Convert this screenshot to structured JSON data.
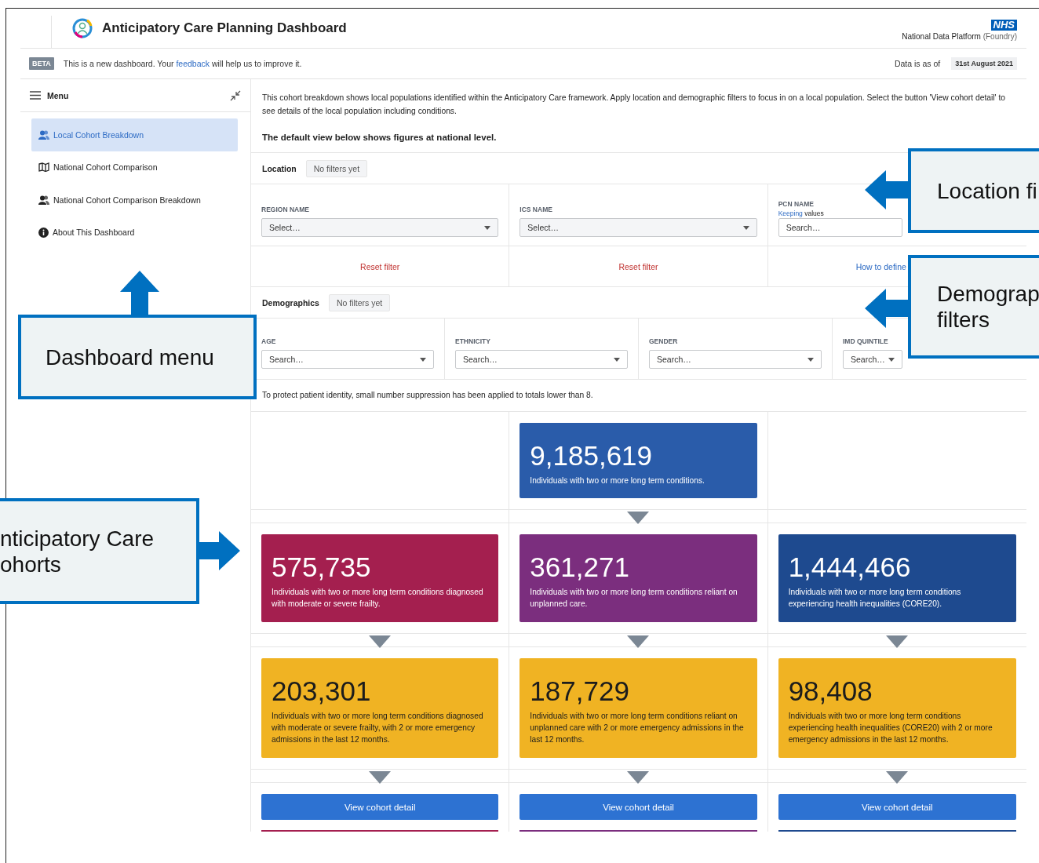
{
  "header": {
    "title": "Anticipatory Care Planning Dashboard",
    "badge": "NHS",
    "platform": "National Data Platform",
    "platform_suffix": "(Foundry)"
  },
  "banner": {
    "badge": "BETA",
    "message_before": "This is a new dashboard. Your ",
    "link": "feedback",
    "message_after": " will help us to improve it.",
    "data_label": "Data is as of",
    "data_date": "31st August 2021"
  },
  "sidebar": {
    "title": "Menu",
    "items": [
      {
        "label": "Local Cohort Breakdown",
        "kind": "people",
        "selected": true
      },
      {
        "label": "National Cohort Comparison",
        "kind": "map",
        "selected": false
      },
      {
        "label": "National Cohort Comparison Breakdown",
        "kind": "people",
        "selected": false
      },
      {
        "label": "About This Dashboard",
        "kind": "info",
        "selected": false
      }
    ]
  },
  "intro": {
    "text": "This cohort breakdown shows local populations identified within the Anticipatory Care framework. Apply location and demographic filters to focus in on a local population. Select the button 'View cohort detail' to see details of the local population including conditions.",
    "note": "The default view below shows figures at national level."
  },
  "location": {
    "label": "Location",
    "status": "No filters yet",
    "filters": [
      {
        "label": "REGION NAME",
        "kind": "select",
        "placeholder": "Select…"
      },
      {
        "label": "ICS NAME",
        "kind": "select",
        "placeholder": "Select…"
      },
      {
        "label": "PCN NAME",
        "kind": "search",
        "hint_link": "Keeping",
        "hint_text": "values",
        "placeholder": "Search…"
      }
    ],
    "actions": [
      {
        "label": "Reset filter",
        "kind": "reset"
      },
      {
        "label": "Reset filter",
        "kind": "reset"
      },
      {
        "label": "How to define",
        "kind": "help"
      }
    ]
  },
  "demographics": {
    "label": "Demographics",
    "status": "No filters yet",
    "filters": [
      {
        "label": "AGE",
        "placeholder": "Search…"
      },
      {
        "label": "ETHNICITY",
        "placeholder": "Search…"
      },
      {
        "label": "GENDER",
        "placeholder": "Search…"
      },
      {
        "label": "IMD QUINTILE",
        "placeholder": "Search…"
      }
    ]
  },
  "suppression_note": "To protect patient identity, small number suppression has been applied to totals lower than 8.",
  "cohorts": {
    "top": {
      "value": "9,185,619",
      "description": "Individuals with two or more long term conditions.",
      "color": "#2a5caa"
    },
    "tiers": [
      {
        "cards": [
          {
            "value": "575,735",
            "description": "Individuals with two or more long term conditions diagnosed with moderate or severe frailty.",
            "color": "#a41f4f"
          },
          {
            "value": "361,271",
            "description": "Individuals with two or more long term conditions reliant on unplanned care.",
            "color": "#7b2e7e"
          },
          {
            "value": "1,444,466",
            "description": "Individuals with two or more long term conditions experiencing health inequalities (CORE20).",
            "color": "#1e4a8f"
          }
        ]
      },
      {
        "cards": [
          {
            "value": "203,301",
            "description": "Individuals with two or more long term conditions diagnosed with moderate or severe frailty, with 2 or more emergency admissions in the last 12 months.",
            "color": "#f0b323"
          },
          {
            "value": "187,729",
            "description": "Individuals with two or more long term conditions reliant on unplanned care with 2 or more emergency admissions in the last 12 months.",
            "color": "#f0b323"
          },
          {
            "value": "98,408",
            "description": "Individuals with two or more long term conditions experiencing health inequalities (CORE20) with 2 or more emergency admissions in the last 12 months.",
            "color": "#f0b323"
          }
        ]
      }
    ],
    "buttons": [
      "View cohort detail",
      "View cohort detail",
      "View cohort detail"
    ],
    "more_cards": [
      {
        "color": "#a41f4f"
      },
      {
        "color": "#7b2e7e"
      },
      {
        "color": "#1e4a8f"
      }
    ]
  },
  "annotations": [
    {
      "kind": "location",
      "lines": [
        "Location fi"
      ]
    },
    {
      "kind": "demographics",
      "lines": [
        "Demograp",
        "filters"
      ]
    },
    {
      "kind": "menu",
      "lines": [
        "Dashboard menu"
      ]
    },
    {
      "kind": "cohorts",
      "lines": [
        "nticipatory Care",
        "ohorts"
      ]
    }
  ]
}
